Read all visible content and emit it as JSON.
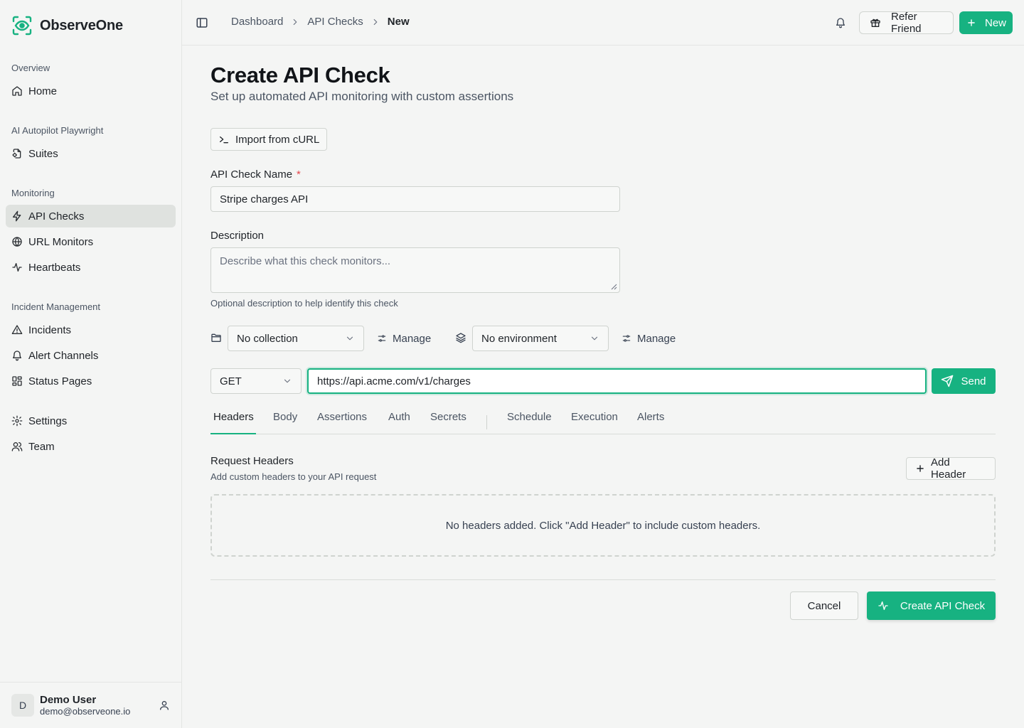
{
  "app": {
    "name": "ObserveOne"
  },
  "colors": {
    "accent": "#17b281",
    "required": "#e5484d"
  },
  "sidebar": {
    "sections": [
      {
        "label": "Overview",
        "items": [
          {
            "label": "Home",
            "icon": "home-icon"
          }
        ]
      },
      {
        "label": "AI Autopilot Playwright",
        "items": [
          {
            "label": "Suites",
            "icon": "suites-icon"
          }
        ]
      },
      {
        "label": "Monitoring",
        "items": [
          {
            "label": "API Checks",
            "icon": "zap-icon",
            "active": true
          },
          {
            "label": "URL Monitors",
            "icon": "globe-icon"
          },
          {
            "label": "Heartbeats",
            "icon": "activity-icon"
          }
        ]
      },
      {
        "label": "Incident Management",
        "items": [
          {
            "label": "Incidents",
            "icon": "warning-icon"
          },
          {
            "label": "Alert Channels",
            "icon": "bell-icon"
          },
          {
            "label": "Status Pages",
            "icon": "layout-icon"
          }
        ]
      },
      {
        "label": "",
        "items": [
          {
            "label": "Settings",
            "icon": "gear-icon"
          },
          {
            "label": "Team",
            "icon": "users-icon"
          }
        ]
      }
    ],
    "user": {
      "initial": "D",
      "name": "Demo User",
      "email": "demo@observeone.io"
    }
  },
  "header": {
    "breadcrumbs": [
      "Dashboard",
      "API Checks",
      "New"
    ],
    "refer_label": "Refer Friend",
    "new_label": "New"
  },
  "main": {
    "title": "Create API Check",
    "subtitle": "Set up automated API monitoring with custom assertions",
    "import_label": "Import from cURL",
    "name_label": "API Check Name",
    "required_mark": "*",
    "name_value": "Stripe charges API",
    "description_label": "Description",
    "description_placeholder": "Describe what this check monitors...",
    "description_help": "Optional description to help identify this check",
    "collection_value": "No collection",
    "environment_value": "No environment",
    "manage_label": "Manage",
    "method_value": "GET",
    "url_value": "https://api.acme.com/v1/charges",
    "send_label": "Send",
    "tabs": [
      "Headers",
      "Body",
      "Assertions",
      "Auth",
      "Secrets",
      "Schedule",
      "Execution",
      "Alerts"
    ],
    "active_tab": "Headers",
    "headers_title": "Request Headers",
    "headers_subtitle": "Add custom headers to your API request",
    "add_header_label": "Add Header",
    "empty_message": "No headers added. Click \"Add Header\" to include custom headers.",
    "cancel_label": "Cancel",
    "create_label": "Create API Check"
  }
}
